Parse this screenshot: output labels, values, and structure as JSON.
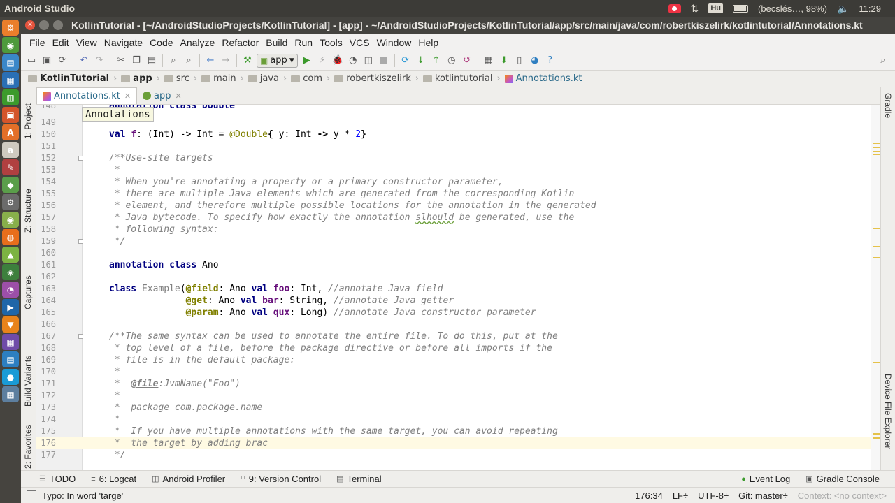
{
  "os_bar": {
    "app_title": "Android Studio",
    "keyboard_layout": "Hu",
    "battery_text": "(becslés…, 98%)",
    "clock": "11:29"
  },
  "launcher": {
    "items": [
      {
        "icon": "terminal-icon",
        "color": "#ea7e2b",
        "glyph": "⚙"
      },
      {
        "icon": "chrome-icon",
        "color": "#4e9a3c",
        "glyph": "◉"
      },
      {
        "icon": "files-icon",
        "color": "#3a87c9",
        "glyph": "▤"
      },
      {
        "icon": "writer-icon",
        "color": "#2a6fb4",
        "glyph": "▦"
      },
      {
        "icon": "calc-icon",
        "color": "#3c9a2c",
        "glyph": "▥"
      },
      {
        "icon": "impress-icon",
        "color": "#d4552a",
        "glyph": "▣"
      },
      {
        "icon": "software-icon",
        "color": "#e26f28",
        "glyph": "A"
      },
      {
        "icon": "amazon-icon",
        "color": "#cfcac0",
        "glyph": "a"
      },
      {
        "icon": "tools-icon",
        "color": "#b04040",
        "glyph": "✎"
      },
      {
        "icon": "studio-icon",
        "color": "#5a9e4a",
        "glyph": "◆"
      },
      {
        "icon": "settings-icon",
        "color": "#6b6b6b",
        "glyph": "⚙"
      },
      {
        "icon": "droid-icon",
        "color": "#88b04b",
        "glyph": "◉"
      },
      {
        "icon": "firefox-icon",
        "color": "#e86e1c",
        "glyph": "◍"
      },
      {
        "icon": "android-icon",
        "color": "#7cb342",
        "glyph": "▲"
      },
      {
        "icon": "studio2-icon",
        "color": "#3d7f3d",
        "glyph": "◈"
      },
      {
        "icon": "color-icon",
        "color": "#9c4fa8",
        "glyph": "◔"
      },
      {
        "icon": "media-icon",
        "color": "#1f66a8",
        "glyph": "▶"
      },
      {
        "icon": "vlc-icon",
        "color": "#e8831a",
        "glyph": "▼"
      },
      {
        "icon": "photos-icon",
        "color": "#6f4ba8",
        "glyph": "▦"
      },
      {
        "icon": "apps-icon",
        "color": "#2d7fc1",
        "glyph": "▤"
      },
      {
        "icon": "skype-icon",
        "color": "#1a9bd6",
        "glyph": "●"
      },
      {
        "icon": "workspace-icon",
        "color": "#5d7f9f",
        "glyph": "▦"
      }
    ]
  },
  "window": {
    "title": "KotlinTutorial - [~/AndroidStudioProjects/KotlinTutorial] - [app] - ~/AndroidStudioProjects/KotlinTutorial/app/src/main/java/com/robertkiszelirk/kotlintutorial/Annotations.kt"
  },
  "menu": [
    "File",
    "Edit",
    "View",
    "Navigate",
    "Code",
    "Analyze",
    "Refactor",
    "Build",
    "Run",
    "Tools",
    "VCS",
    "Window",
    "Help"
  ],
  "toolbar": {
    "config_label": "app"
  },
  "breadcrumbs": [
    "KotlinTutorial",
    "app",
    "src",
    "main",
    "java",
    "com",
    "robertkiszelirk",
    "kotlintutorial",
    "Annotations.kt"
  ],
  "editor_tabs": [
    {
      "label": "Annotations.kt",
      "active": true
    },
    {
      "label": "app",
      "active": false
    }
  ],
  "tooltip": "Annotations",
  "left_tool_windows": [
    "1: Project",
    "Z: Structure",
    "Captures",
    "Build Variants",
    "2: Favorites"
  ],
  "right_tool_windows": [
    "Gradle",
    "Device File Explorer"
  ],
  "code": {
    "first_partial": {
      "number": "148",
      "text": "annotation class Double"
    },
    "lines": [
      {
        "n": "149"
      },
      {
        "n": "150"
      },
      {
        "n": "151"
      },
      {
        "n": "152"
      },
      {
        "n": "153"
      },
      {
        "n": "154"
      },
      {
        "n": "155"
      },
      {
        "n": "156"
      },
      {
        "n": "157"
      },
      {
        "n": "158"
      },
      {
        "n": "159"
      },
      {
        "n": "160"
      },
      {
        "n": "161"
      },
      {
        "n": "162"
      },
      {
        "n": "163"
      },
      {
        "n": "164"
      },
      {
        "n": "165"
      },
      {
        "n": "166"
      },
      {
        "n": "167"
      },
      {
        "n": "168"
      },
      {
        "n": "169"
      },
      {
        "n": "170"
      },
      {
        "n": "171"
      },
      {
        "n": "172"
      },
      {
        "n": "173"
      },
      {
        "n": "174"
      },
      {
        "n": "175"
      },
      {
        "n": "176"
      },
      {
        "n": "177"
      }
    ]
  },
  "bottom_tabs": {
    "todo": "TODO",
    "logcat": "6: Logcat",
    "profiler": "Android Profiler",
    "vcs": "9: Version Control",
    "terminal": "Terminal",
    "eventlog": "Event Log",
    "gradle_console": "Gradle Console"
  },
  "status": {
    "message": "Typo: In word 'targe'",
    "position": "176:34",
    "line_sep": "LF÷",
    "encoding": "UTF-8÷",
    "git": "Git: master÷",
    "context": "Context: <no context>"
  },
  "colors": {
    "keyword": "#000080",
    "comment": "#808080",
    "annotation": "#808000",
    "number": "#0000ff",
    "field": "#660e7a",
    "current_line": "#fffae3"
  }
}
